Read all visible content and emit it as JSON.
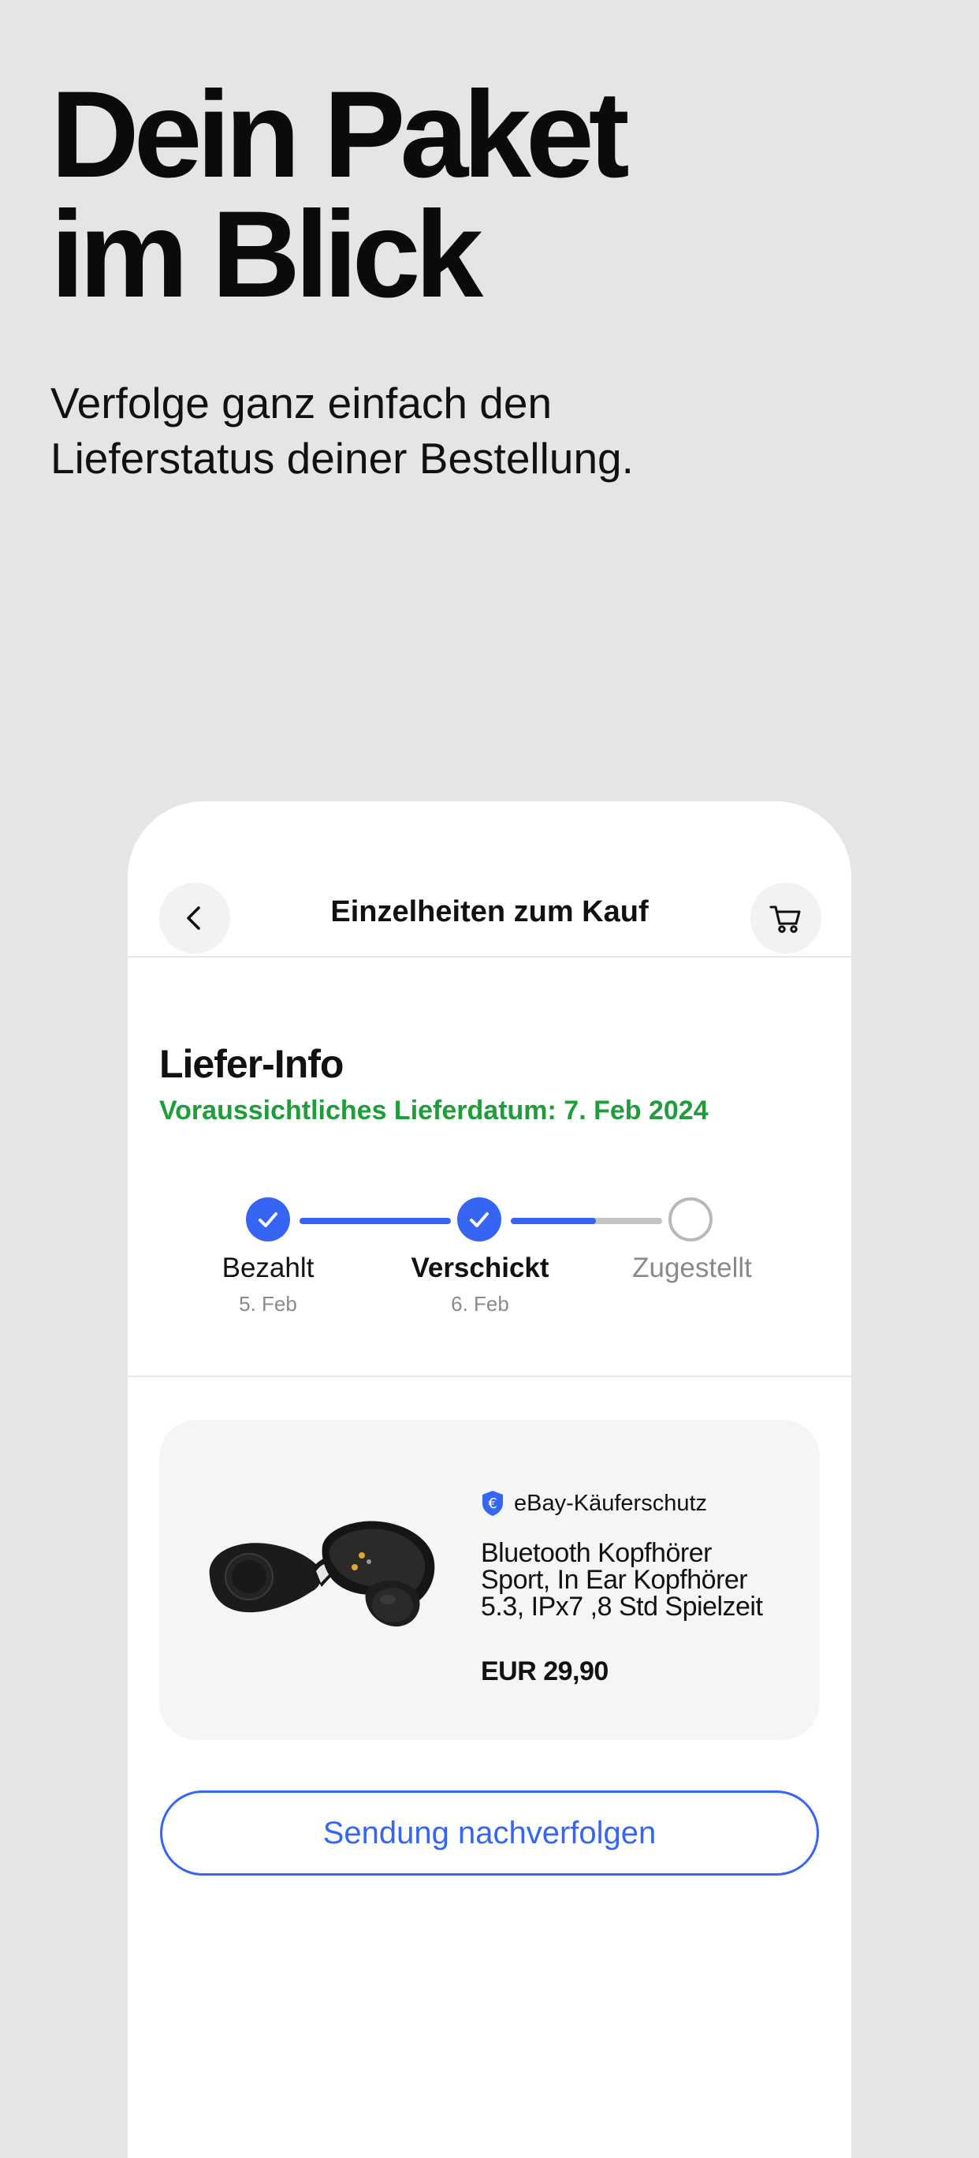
{
  "promo": {
    "headline_line1": "Dein Paket",
    "headline_line2": "im Blick",
    "subtitle_line1": "Verfolge ganz einfach den",
    "subtitle_line2": "Lieferstatus deiner Bestellung."
  },
  "header": {
    "title": "Einzelheiten zum Kauf",
    "back_icon": "chevron-left-icon",
    "cart_icon": "cart-icon"
  },
  "delivery": {
    "section_title": "Liefer-Info",
    "estimated_date": "Voraussichtliches Lieferdatum: 7. Feb 2024",
    "progress_between_step2_and_step3": 0.56,
    "steps": [
      {
        "label": "Bezahlt",
        "date": "5. Feb",
        "status": "done"
      },
      {
        "label": "Verschickt",
        "date": "6. Feb",
        "status": "done"
      },
      {
        "label": "Zugestellt",
        "date": "",
        "status": "pending"
      }
    ]
  },
  "item": {
    "protection_label": "eBay-Käuferschutz",
    "protection_icon": "euro-shield-icon",
    "title_line1": "Bluetooth Kopfhörer",
    "title_line2": "Sport, In Ear Kopfhörer",
    "title_line3": "5.3, IPx7 ,8 Std Spielzeit",
    "price": "EUR 29,90",
    "image": "wireless-earbuds-image"
  },
  "actions": {
    "track_label": "Sendung nachverfolgen"
  },
  "colors": {
    "accent": "#3665f3",
    "success": "#1f9d3a",
    "background": "#e5e5e5",
    "card": "#f5f5f5",
    "muted": "#8a8a8a"
  }
}
